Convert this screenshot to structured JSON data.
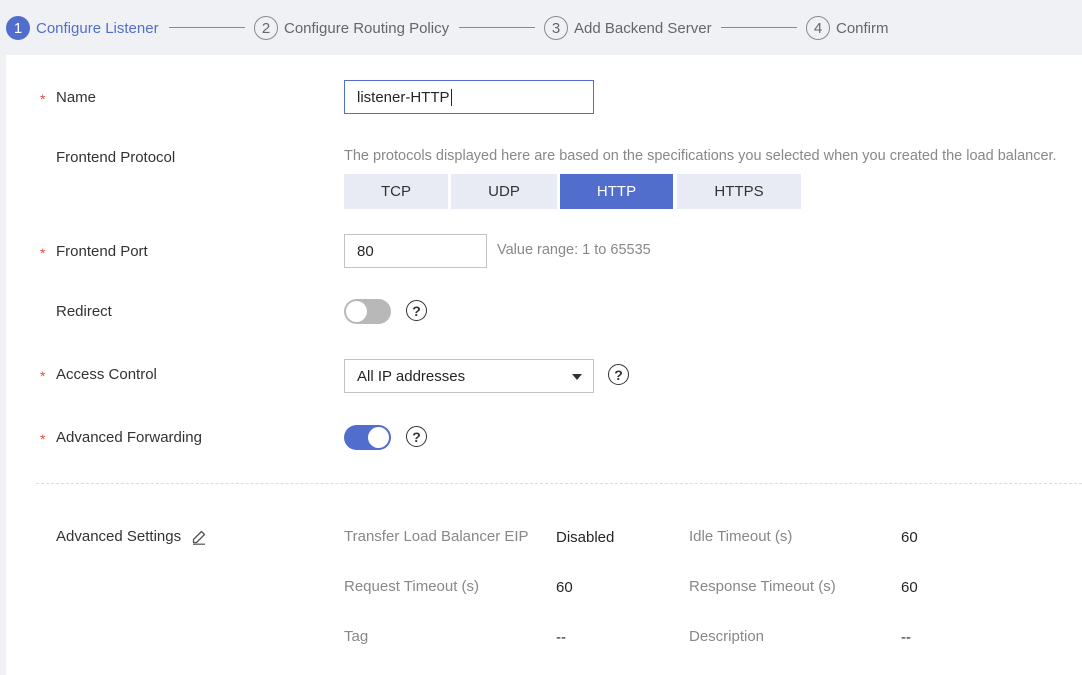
{
  "steps": [
    {
      "num": "1",
      "label": "Configure Listener"
    },
    {
      "num": "2",
      "label": "Configure Routing Policy"
    },
    {
      "num": "3",
      "label": "Add Backend Server"
    },
    {
      "num": "4",
      "label": "Confirm"
    }
  ],
  "required_mark": "*",
  "form": {
    "name": {
      "label": "Name",
      "value": "listener-HTTP"
    },
    "frontend_protocol": {
      "label": "Frontend Protocol",
      "hint": "The protocols displayed here are based on the specifications you selected when you created the load balancer.",
      "options": [
        "TCP",
        "UDP",
        "HTTP",
        "HTTPS"
      ],
      "selected": "HTTP"
    },
    "frontend_port": {
      "label": "Frontend Port",
      "value": "80",
      "hint": "Value range: 1 to 65535"
    },
    "redirect": {
      "label": "Redirect",
      "enabled": false
    },
    "access_control": {
      "label": "Access Control",
      "value": "All IP addresses"
    },
    "advanced_forwarding": {
      "label": "Advanced Forwarding",
      "enabled": true
    }
  },
  "advanced_settings": {
    "label": "Advanced Settings",
    "items": [
      {
        "key": "Transfer Load Balancer EIP",
        "value": "Disabled"
      },
      {
        "key": "Idle Timeout (s)",
        "value": "60"
      },
      {
        "key": "Request Timeout (s)",
        "value": "60"
      },
      {
        "key": "Response Timeout (s)",
        "value": "60"
      },
      {
        "key": "Tag",
        "value": "--"
      },
      {
        "key": "Description",
        "value": "--"
      }
    ]
  },
  "icons": {
    "help": "question-mark-circle-icon",
    "edit": "pencil-icon",
    "dropdown": "caret-down-icon"
  },
  "colors": {
    "accent": "#526ecc",
    "required": "#e74c3c",
    "segment_bg": "#e8ebf4",
    "toggle_off": "#b8b8b8"
  }
}
